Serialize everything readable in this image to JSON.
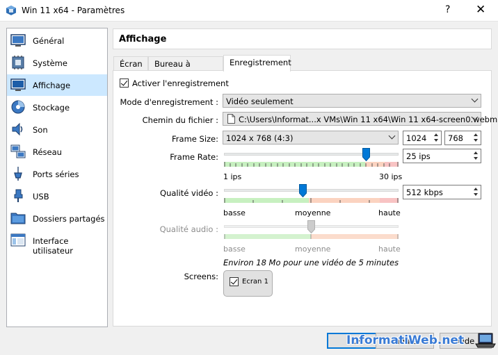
{
  "window": {
    "title": "Win 11 x64 - Paramètres",
    "help": "?",
    "close": "✕"
  },
  "sidebar": {
    "items": [
      {
        "label": "Général",
        "icon": "general-icon"
      },
      {
        "label": "Système",
        "icon": "system-icon"
      },
      {
        "label": "Affichage",
        "icon": "display-icon",
        "selected": true
      },
      {
        "label": "Stockage",
        "icon": "storage-icon"
      },
      {
        "label": "Son",
        "icon": "audio-icon"
      },
      {
        "label": "Réseau",
        "icon": "network-icon"
      },
      {
        "label": "Ports séries",
        "icon": "serial-ports-icon"
      },
      {
        "label": "USB",
        "icon": "usb-icon"
      },
      {
        "label": "Dossiers partagés",
        "icon": "shared-folders-icon"
      },
      {
        "label": "Interface utilisateur",
        "icon": "user-interface-icon"
      }
    ]
  },
  "page": {
    "title": "Affichage"
  },
  "tabs": [
    {
      "label": "Écran"
    },
    {
      "label": "Bureau à distance"
    },
    {
      "label": "Enregistrement",
      "active": true
    }
  ],
  "recording": {
    "enable_label": "Activer l'enregistrement",
    "enabled": true,
    "mode_label": "Mode d'enregistrement :",
    "mode_value": "Vidéo seulement",
    "file_label": "Chemin du fichier :",
    "file_value": "C:\\Users\\Informat...x VMs\\Win 11 x64\\Win 11 x64-screen0.webm",
    "frame_size_label": "Frame Size:",
    "frame_size_value": "1024 x 768 (4:3)",
    "frame_width": "1024",
    "frame_height": "768",
    "frame_rate_label": "Frame Rate:",
    "frame_rate_value": "25 ips",
    "frame_rate_fraction": 0.83,
    "frame_rate_min": "1 ips",
    "frame_rate_max": "30 ips",
    "video_quality_label": "Qualité vidéo :",
    "video_quality_value": "512 kbps",
    "video_quality_fraction": 0.45,
    "audio_quality_label": "Qualité audio :",
    "audio_quality_fraction": 0.5,
    "scale_low": "basse",
    "scale_mid": "moyenne",
    "scale_high": "haute",
    "estimate": "Environ 18 Mo pour une vidéo de 5 minutes",
    "screens_label": "Screens:",
    "screen1_label": "Ecran 1",
    "screen1_checked": true
  },
  "buttons": {
    "ok": "OK",
    "cancel": "Annuler",
    "help": "Aide"
  },
  "watermark": "InformatiWeb.net",
  "colors": {
    "selection": "#cce8ff",
    "slider_handle": "#0078d7",
    "scale_green": "#c7f0c0",
    "scale_orange": "#fbd3c0",
    "scale_red": "#f8c3c3"
  }
}
